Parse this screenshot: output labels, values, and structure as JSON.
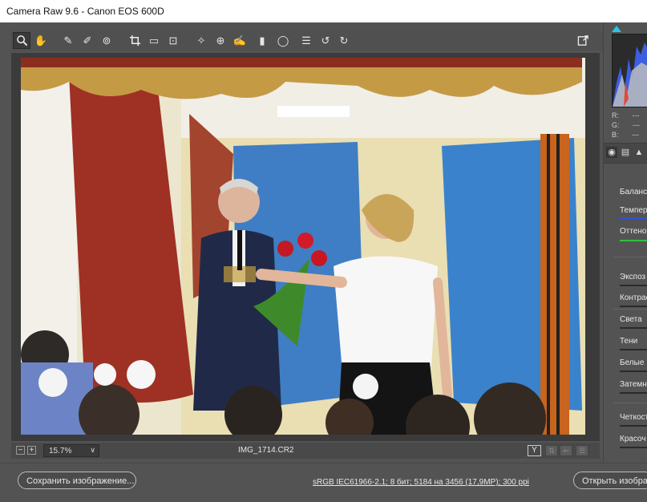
{
  "window": {
    "title": "Camera Raw 9.6  -  Canon EOS 600D"
  },
  "toolbar": {
    "tools": [
      {
        "name": "zoom-tool",
        "icon": "magnifier-icon",
        "glyph": "⌕",
        "active": true
      },
      {
        "name": "hand-tool",
        "icon": "hand-icon",
        "glyph": "✋"
      },
      {
        "name": "white-balance-tool",
        "icon": "eyedropper-icon",
        "glyph": "✎"
      },
      {
        "name": "color-sampler-tool",
        "icon": "color-sampler-icon",
        "glyph": "✐"
      },
      {
        "name": "targeted-adjustment-tool",
        "icon": "targeted-adjustment-icon",
        "glyph": "⊚"
      },
      {
        "name": "crop-tool",
        "icon": "crop-icon",
        "glyph": "⌗"
      },
      {
        "name": "straighten-tool",
        "icon": "straighten-icon",
        "glyph": "▭"
      },
      {
        "name": "transform-tool",
        "icon": "transform-icon",
        "glyph": "⊡"
      },
      {
        "name": "spot-removal-tool",
        "icon": "spot-removal-icon",
        "glyph": "✧"
      },
      {
        "name": "red-eye-tool",
        "icon": "red-eye-icon",
        "glyph": "⊕"
      },
      {
        "name": "adjustment-brush-tool",
        "icon": "brush-icon",
        "glyph": "✍"
      },
      {
        "name": "graduated-filter-tool",
        "icon": "graduated-filter-icon",
        "glyph": "▮"
      },
      {
        "name": "radial-filter-tool",
        "icon": "radial-filter-icon",
        "glyph": "◯"
      },
      {
        "name": "preferences-tool",
        "icon": "list-icon",
        "glyph": "☰"
      },
      {
        "name": "rotate-ccw-tool",
        "icon": "rotate-left-icon",
        "glyph": "↺"
      },
      {
        "name": "rotate-cw-tool",
        "icon": "rotate-right-icon",
        "glyph": "↻"
      }
    ],
    "fullscreen_icon": "fullscreen-icon"
  },
  "statusbar": {
    "zoom_out": "−",
    "zoom_in": "+",
    "zoom_value": "15.7%",
    "zoom_caret": "∨",
    "filename": "IMG_1714.CR2",
    "y_button": "Y"
  },
  "bottom": {
    "save_label": "Сохранить изображение...",
    "workflow": "sRGB IEC61966-2.1; 8 бит; 5184 на 3456 (17,9МР); 300 ppi",
    "open_label": "Открыть изображение"
  },
  "panel": {
    "rgb": {
      "r": "R:",
      "g": "G:",
      "b": "B:",
      "value": "---"
    },
    "tabs": [
      "◉",
      "▤",
      "▲"
    ],
    "labels": {
      "wb": "Баланс б",
      "temp": "Темпера",
      "tint": "Оттенок",
      "exposure": "Экспоз",
      "contrast": "Контраст",
      "highlights": "Света",
      "shadows": "Тени",
      "whites": "Белые",
      "blacks": "Затемн",
      "clarity": "Четкость",
      "vibrance": "Красоч"
    }
  },
  "colors": {
    "background": "#535353",
    "accent_temp": "#3050e0",
    "accent_tint": "#30c040"
  }
}
